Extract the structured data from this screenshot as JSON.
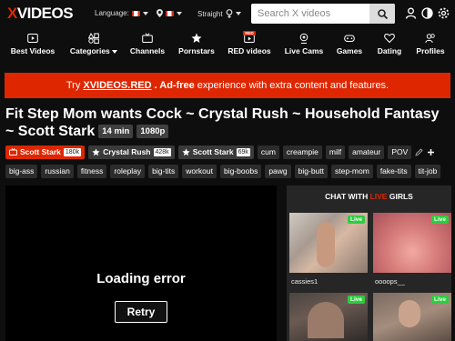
{
  "header": {
    "logo_x": "X",
    "logo_rest": "VIDEOS",
    "language_label": "Language:",
    "straight_label": "Straight",
    "search_placeholder": "Search X videos"
  },
  "nav": [
    {
      "label": "Best Videos",
      "icon": "play-icon"
    },
    {
      "label": "Categories",
      "icon": "categories-icon"
    },
    {
      "label": "Channels",
      "icon": "channels-icon"
    },
    {
      "label": "Pornstars",
      "icon": "star-icon"
    },
    {
      "label": "RED videos",
      "icon": "red-icon",
      "badge": "RED"
    },
    {
      "label": "Live Cams",
      "icon": "cam-icon"
    },
    {
      "label": "Games",
      "icon": "gamepad-icon"
    },
    {
      "label": "Dating",
      "icon": "dating-icon"
    },
    {
      "label": "Profiles",
      "icon": "profiles-icon"
    }
  ],
  "promo": {
    "pre": "Try",
    "link": "XVIDEOS.RED",
    "bold": ". Ad-free",
    "post": "experience with extra content and features."
  },
  "video": {
    "title": "Fit Step Mom wants Cock ~ Crystal Rush ~ Household Fantasy ~ Scott Stark",
    "duration": "14 min",
    "quality": "1080p"
  },
  "models": [
    {
      "name": "Scott Stark",
      "count": "180k"
    },
    {
      "name": "Crystal Rush",
      "count": "428k"
    },
    {
      "name": "Scott Stark",
      "count": "69k"
    }
  ],
  "tags_row1": [
    "cum",
    "creampie",
    "milf",
    "amateur",
    "POV"
  ],
  "tags_row2": [
    "big-ass",
    "russian",
    "fitness",
    "roleplay",
    "big-tits",
    "workout",
    "big-boobs",
    "pawg",
    "big-butt",
    "step-mom",
    "fake-tits",
    "tit-job"
  ],
  "player": {
    "error": "Loading error",
    "retry": "Retry"
  },
  "chat": {
    "heading_pre": "CHAT WITH ",
    "heading_live": "LIVE",
    "heading_post": " GIRLS",
    "live_badge": "Live",
    "cams": [
      {
        "name": "cassies1"
      },
      {
        "name": "oooops__"
      },
      {
        "name": ""
      },
      {
        "name": ""
      }
    ]
  },
  "colors": {
    "accent": "#de2600",
    "live_green": "#2ecc40",
    "background": "#0e0e0e"
  }
}
